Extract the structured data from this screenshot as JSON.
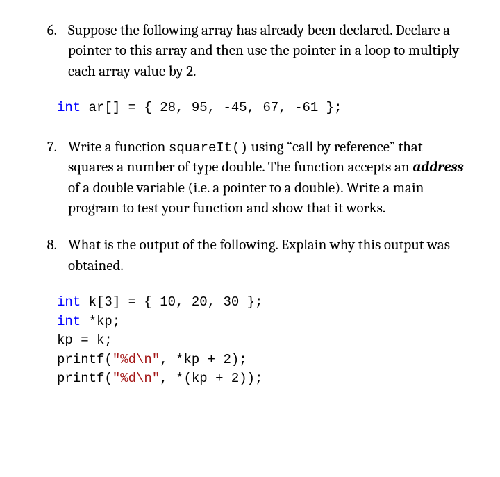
{
  "q6": {
    "num": "6.",
    "text": "Suppose the following array has already been declared. Declare a pointer to this array and then use the pointer in a loop to multiply each array value by 2."
  },
  "code6": {
    "kw1": "int",
    "rest": " ar[] = { 28, 95, -45, 67, -61 };"
  },
  "q7": {
    "num": "7.",
    "pre": "Write a function ",
    "fn": "squareIt()",
    "mid1": " using “call by reference” that squares a number of type double. The function accepts an ",
    "addr": "address",
    "mid2": "  of a double variable (i.e. a pointer to a double). Write a main program to test your function and show that it works."
  },
  "q8": {
    "num": "8.",
    "text": "What is the output of the following. Explain why this output was obtained."
  },
  "code8": {
    "l1_kw": "int",
    "l1_rest": " k[3] = { 10, 20, 30 };",
    "l2_kw": "int",
    "l2_rest": " *kp;",
    "l3": "kp = k;",
    "l4_pre": "printf(",
    "l4_str": "\"%d\\n\"",
    "l4_post": ", *kp + 2);",
    "l5_pre": "printf(",
    "l5_str": "\"%d\\n\"",
    "l5_post": ", *(kp + 2));"
  }
}
